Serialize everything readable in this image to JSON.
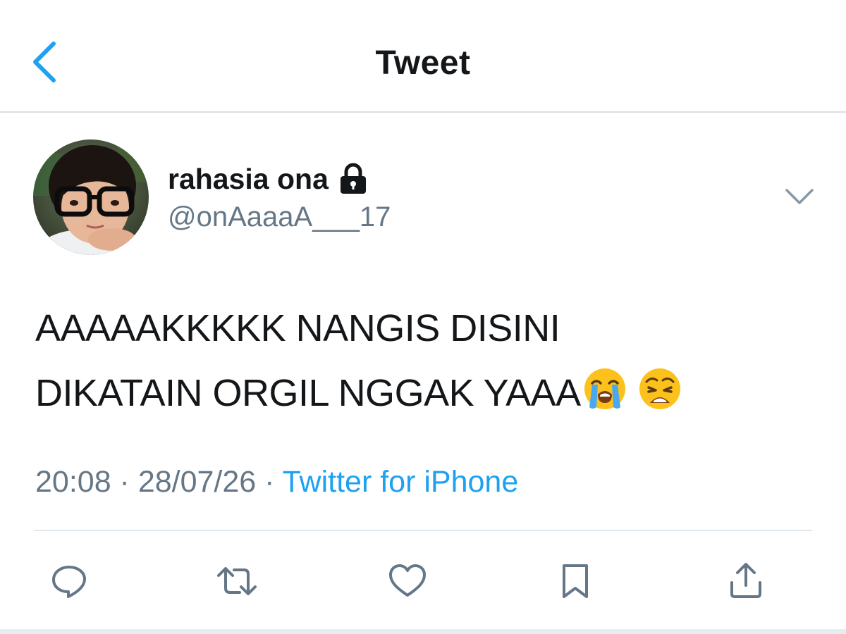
{
  "header": {
    "title": "Tweet",
    "back_icon": "chevron-left-icon"
  },
  "author": {
    "display_name": "rahasia ona",
    "handle": "@onAaaaA___17",
    "protected_icon": "lock-icon",
    "menu_icon": "chevron-down-icon"
  },
  "tweet": {
    "text_line1": "AAAAAKKKKK NANGIS DISINI",
    "text_line2": "DIKATAIN ORGIL NGGAK YAAA",
    "emojis": [
      "loudly-crying-face-emoji",
      "weary-face-emoji"
    ]
  },
  "meta": {
    "time": "20:08",
    "separator": " · ",
    "date": "28/07/26",
    "source": "Twitter for iPhone"
  },
  "actions": [
    {
      "icon": "reply-icon"
    },
    {
      "icon": "retweet-icon"
    },
    {
      "icon": "like-icon"
    },
    {
      "icon": "bookmark-icon"
    },
    {
      "icon": "share-icon"
    }
  ],
  "colors": {
    "accent": "#1da1f2",
    "text_primary": "#14171a",
    "text_secondary": "#657786",
    "icon": "#657786",
    "divider": "#e1e8ed"
  }
}
